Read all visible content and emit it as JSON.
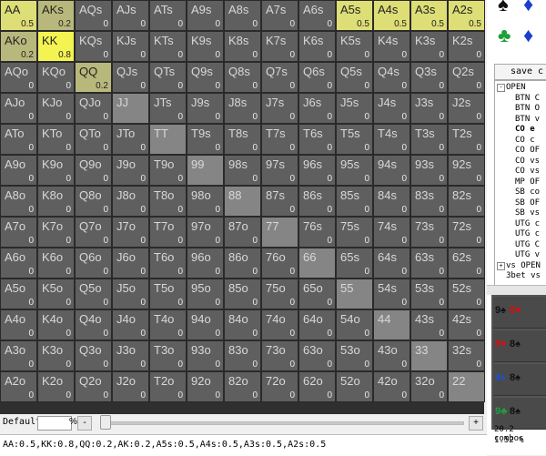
{
  "grid": {
    "rows": [
      [
        "AA",
        "AKs",
        "AQs",
        "AJs",
        "ATs",
        "A9s",
        "A8s",
        "A7s",
        "A6s",
        "A5s",
        "A4s",
        "A3s",
        "A2s"
      ],
      [
        "AKo",
        "KK",
        "KQs",
        "KJs",
        "KTs",
        "K9s",
        "K8s",
        "K7s",
        "K6s",
        "K5s",
        "K4s",
        "K3s",
        "K2s"
      ],
      [
        "AQo",
        "KQo",
        "QQ",
        "QJs",
        "QTs",
        "Q9s",
        "Q8s",
        "Q7s",
        "Q6s",
        "Q5s",
        "Q4s",
        "Q3s",
        "Q2s"
      ],
      [
        "AJo",
        "KJo",
        "QJo",
        "JJ",
        "JTs",
        "J9s",
        "J8s",
        "J7s",
        "J6s",
        "J5s",
        "J4s",
        "J3s",
        "J2s"
      ],
      [
        "ATo",
        "KTo",
        "QTo",
        "JTo",
        "TT",
        "T9s",
        "T8s",
        "T7s",
        "T6s",
        "T5s",
        "T4s",
        "T3s",
        "T2s"
      ],
      [
        "A9o",
        "K9o",
        "Q9o",
        "J9o",
        "T9o",
        "99",
        "98s",
        "97s",
        "96s",
        "95s",
        "94s",
        "93s",
        "92s"
      ],
      [
        "A8o",
        "K8o",
        "Q8o",
        "J8o",
        "T8o",
        "98o",
        "88",
        "87s",
        "86s",
        "85s",
        "84s",
        "83s",
        "82s"
      ],
      [
        "A7o",
        "K7o",
        "Q7o",
        "J7o",
        "T7o",
        "97o",
        "87o",
        "77",
        "76s",
        "75s",
        "74s",
        "73s",
        "72s"
      ],
      [
        "A6o",
        "K6o",
        "Q6o",
        "J6o",
        "T6o",
        "96o",
        "86o",
        "76o",
        "66",
        "65s",
        "64s",
        "63s",
        "62s"
      ],
      [
        "A5o",
        "K5o",
        "Q5o",
        "J5o",
        "T5o",
        "95o",
        "85o",
        "75o",
        "65o",
        "55",
        "54s",
        "53s",
        "52s"
      ],
      [
        "A4o",
        "K4o",
        "Q4o",
        "J4o",
        "T4o",
        "94o",
        "84o",
        "74o",
        "64o",
        "54o",
        "44",
        "43s",
        "42s"
      ],
      [
        "A3o",
        "K3o",
        "Q3o",
        "J3o",
        "T3o",
        "93o",
        "83o",
        "73o",
        "63o",
        "53o",
        "43o",
        "33",
        "32s"
      ],
      [
        "A2o",
        "K2o",
        "Q2o",
        "J2o",
        "T2o",
        "92o",
        "82o",
        "72o",
        "62o",
        "52o",
        "42o",
        "32o",
        "22"
      ]
    ],
    "values": [
      [
        "0.5",
        "0.2",
        "0",
        "0",
        "0",
        "0",
        "0",
        "0",
        "0",
        "0.5",
        "0.5",
        "0.5",
        "0.5"
      ],
      [
        "0.2",
        "0.8",
        "0",
        "0",
        "0",
        "0",
        "0",
        "0",
        "0",
        "0",
        "0",
        "0",
        "0"
      ],
      [
        "0",
        "0",
        "0.2",
        "0",
        "0",
        "0",
        "0",
        "0",
        "0",
        "0",
        "0",
        "0",
        "0"
      ],
      [
        "0",
        "0",
        "0",
        "",
        "0",
        "0",
        "0",
        "0",
        "0",
        "0",
        "0",
        "0",
        "0"
      ],
      [
        "0",
        "0",
        "0",
        "0",
        "",
        "0",
        "0",
        "0",
        "0",
        "0",
        "0",
        "0",
        "0"
      ],
      [
        "0",
        "0",
        "0",
        "0",
        "0",
        "",
        "0",
        "0",
        "0",
        "0",
        "0",
        "0",
        "0"
      ],
      [
        "0",
        "0",
        "0",
        "0",
        "0",
        "0",
        "",
        "0",
        "0",
        "0",
        "0",
        "0",
        "0"
      ],
      [
        "0",
        "0",
        "0",
        "0",
        "0",
        "0",
        "0",
        "",
        "0",
        "0",
        "0",
        "0",
        "0"
      ],
      [
        "0",
        "0",
        "0",
        "0",
        "0",
        "0",
        "0",
        "0",
        "",
        "0",
        "0",
        "0",
        "0"
      ],
      [
        "0",
        "0",
        "0",
        "0",
        "0",
        "0",
        "0",
        "0",
        "0",
        "",
        "0",
        "0",
        "0"
      ],
      [
        "0",
        "0",
        "0",
        "0",
        "0",
        "0",
        "0",
        "0",
        "0",
        "0",
        "",
        "0",
        "0"
      ],
      [
        "0",
        "0",
        "0",
        "0",
        "0",
        "0",
        "0",
        "0",
        "0",
        "0",
        "0",
        "",
        "0"
      ],
      [
        "0",
        "0",
        "0",
        "0",
        "0",
        "0",
        "0",
        "0",
        "0",
        "0",
        "0",
        "0",
        ""
      ]
    ]
  },
  "colors": {
    "weight_0_2": "#b9b87c",
    "weight_0_5": "#dede76",
    "weight_0_8": "#f3f352",
    "pair_empty": "#858585",
    "cell_default": "#5f5f5f"
  },
  "controls": {
    "range_label": "Default",
    "percent_value": "",
    "percent_sign": "%",
    "minus_label": "-",
    "plus_label": "+"
  },
  "range_string": "AA:0.5,KK:0.8,QQ:0.2,AK:0.2,A5s:0.5,A4s:0.5,A3s:0.5,A2s:0.5",
  "sidebar": {
    "suits": {
      "spade": "♠",
      "diamond": "♦",
      "club": "♣"
    },
    "save_label": "save c",
    "tree": [
      {
        "label": "OPEN",
        "indent": 0,
        "toggle": "-",
        "bold": false
      },
      {
        "label": "BTN C",
        "indent": 1,
        "toggle": "",
        "bold": false
      },
      {
        "label": "BTN O",
        "indent": 1,
        "toggle": "",
        "bold": false
      },
      {
        "label": "BTN v",
        "indent": 1,
        "toggle": "",
        "bold": false
      },
      {
        "label": "CO e",
        "indent": 1,
        "toggle": "",
        "bold": true
      },
      {
        "label": "CO c",
        "indent": 1,
        "toggle": "",
        "bold": false
      },
      {
        "label": "CO OF",
        "indent": 1,
        "toggle": "",
        "bold": false
      },
      {
        "label": "CO vs",
        "indent": 1,
        "toggle": "",
        "bold": false
      },
      {
        "label": "CO vs",
        "indent": 1,
        "toggle": "",
        "bold": false
      },
      {
        "label": "MP OF",
        "indent": 1,
        "toggle": "",
        "bold": false
      },
      {
        "label": "SB co",
        "indent": 1,
        "toggle": "",
        "bold": false
      },
      {
        "label": "SB OF",
        "indent": 1,
        "toggle": "",
        "bold": false
      },
      {
        "label": "SB vs",
        "indent": 1,
        "toggle": "",
        "bold": false
      },
      {
        "label": "UTG c",
        "indent": 1,
        "toggle": "",
        "bold": false
      },
      {
        "label": "UTG c",
        "indent": 1,
        "toggle": "",
        "bold": false
      },
      {
        "label": "UTG C",
        "indent": 1,
        "toggle": "",
        "bold": false
      },
      {
        "label": "UTG v",
        "indent": 1,
        "toggle": "",
        "bold": false
      },
      {
        "label": "vs OPEN",
        "indent": 0,
        "toggle": "+",
        "bold": false
      },
      {
        "label": "3bet vs",
        "indent": 0,
        "toggle": "",
        "bold": false
      }
    ],
    "board_rows": [
      {
        "cards": [
          {
            "text": "9♠",
            "color": "#111111"
          },
          {
            "text": "8♥",
            "color": "#d01010"
          }
        ]
      },
      {
        "cards": [
          {
            "text": "9♥",
            "color": "#d01010"
          },
          {
            "text": "8♠",
            "color": "#111111"
          }
        ]
      },
      {
        "cards": [
          {
            "text": "9♦",
            "color": "#2050d0"
          },
          {
            "text": "8♠",
            "color": "#111111"
          }
        ]
      },
      {
        "cards": [
          {
            "text": "9♣",
            "color": "#20a040"
          },
          {
            "text": "8♠",
            "color": "#111111"
          }
        ]
      }
    ],
    "combos_text": "20.2 combos",
    "percent_text": "1.52 %"
  }
}
